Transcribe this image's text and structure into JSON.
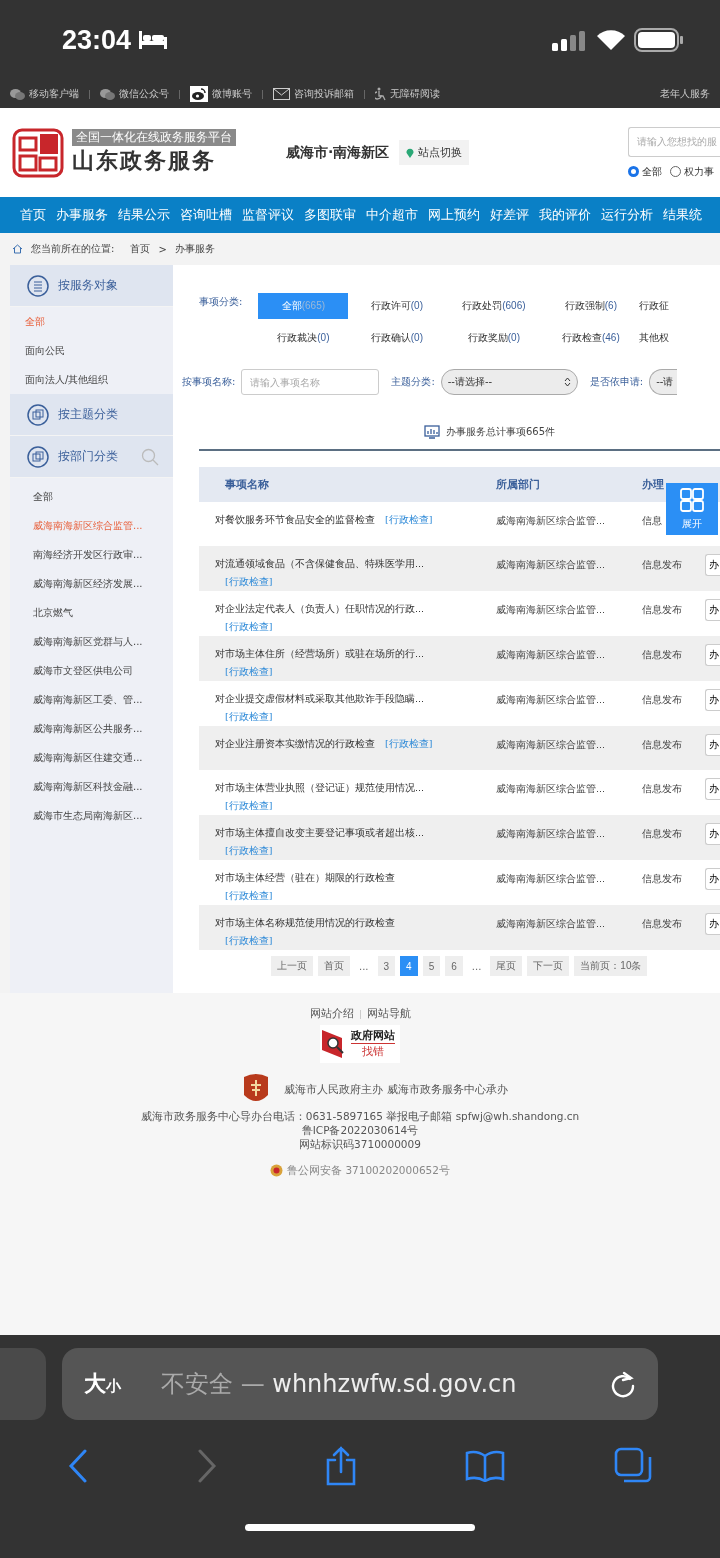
{
  "status_bar": {
    "time": "23:04"
  },
  "top_links": [
    {
      "label": "移动客户端",
      "kind": "phone"
    },
    {
      "label": "微信公众号",
      "kind": "wechat"
    },
    {
      "label": "微博账号",
      "kind": "weibo"
    },
    {
      "label": "咨询投诉邮箱",
      "kind": "mail"
    },
    {
      "label": "无障碍阅读",
      "kind": "access"
    }
  ],
  "top_right_link": "老年人服务",
  "header": {
    "platform_tag": "全国一体化在线政务服务平台",
    "site_name": "山东政务服务",
    "region": "威海市·南海新区",
    "switch_button": "站点切换",
    "search_placeholder": "请输入您想找的服",
    "scopes": [
      {
        "label": "全部",
        "selected": true
      },
      {
        "label": "权力事",
        "selected": false
      }
    ]
  },
  "nav": [
    "首页",
    "办事服务",
    "结果公示",
    "咨询吐槽",
    "监督评议",
    "多图联审",
    "中介超市",
    "网上预约",
    "好差评",
    "我的评价",
    "运行分析",
    "结果统"
  ],
  "breadcrumb": {
    "prefix": "您当前所在的位置:",
    "items": [
      "首页",
      "办事服务"
    ],
    "separator": ">"
  },
  "sidebar": [
    {
      "title": "按服务对象",
      "search": false,
      "items": [
        {
          "label": "全部",
          "selected": true
        },
        {
          "label": "面向公民",
          "selected": false
        },
        {
          "label": "面向法人/其他组织",
          "selected": false
        }
      ]
    },
    {
      "title": "按主题分类",
      "search": false
    },
    {
      "title": "按部门分类",
      "search": true,
      "items": [
        {
          "label": "全部",
          "selected": false
        },
        {
          "label": "威海南海新区综合监管...",
          "selected": true
        },
        {
          "label": "南海经济开发区行政审...",
          "selected": false
        },
        {
          "label": "威海南海新区经济发展...",
          "selected": false
        },
        {
          "label": "北京燃气",
          "selected": false
        },
        {
          "label": "威海南海新区党群与人...",
          "selected": false
        },
        {
          "label": "威海市文登区供电公司",
          "selected": false
        },
        {
          "label": "威海南海新区工委、管...",
          "selected": false
        },
        {
          "label": "威海南海新区公共服务...",
          "selected": false
        },
        {
          "label": "威海南海新区住建交通...",
          "selected": false
        },
        {
          "label": "威海南海新区科技金融...",
          "selected": false
        },
        {
          "label": "威海市生态局南海新区...",
          "selected": false
        }
      ]
    }
  ],
  "filters": {
    "category_label": "事项分类:",
    "categories": [
      {
        "name": "全部",
        "count": "(665)",
        "selected": true
      },
      {
        "name": "行政许可",
        "count": "(0)",
        "selected": false
      },
      {
        "name": "行政处罚",
        "count": "(606)",
        "selected": false
      },
      {
        "name": "行政强制",
        "count": "(6)",
        "selected": false
      },
      {
        "name": "行政征",
        "selected": false
      },
      {
        "name": "行政裁决",
        "count": "(0)",
        "selected": false
      },
      {
        "name": "行政确认",
        "count": "(0)",
        "selected": false
      },
      {
        "name": "行政奖励",
        "count": "(0)",
        "selected": false
      },
      {
        "name": "行政检查",
        "count": "(46)",
        "selected": false
      },
      {
        "name": "其他权",
        "selected": false
      }
    ],
    "name_label": "按事项名称:",
    "name_placeholder": "请输入事项名称",
    "theme_label": "主题分类:",
    "theme_value": "--请选择--",
    "apply_label": "是否依申请:",
    "apply_value": "--请"
  },
  "summary": "办事服务总计事项665件",
  "table": {
    "columns": [
      "事项名称",
      "所属部门",
      "办理"
    ],
    "rows": [
      {
        "name": "对餐饮服务环节食品安全的监督检查",
        "tag": "[行政检查]",
        "department": "威海南海新区综合监管...",
        "status": "信息"
      },
      {
        "name": "对流通领域食品（不含保健食品、特殊医学用...",
        "tag": "[行政检查]",
        "department": "威海南海新区综合监管...",
        "status": "信息发布",
        "action": "办"
      },
      {
        "name": "对企业法定代表人（负责人）任职情况的行政...",
        "tag": "[行政检查]",
        "department": "威海南海新区综合监管...",
        "status": "信息发布",
        "action": "办"
      },
      {
        "name": "对市场主体住所（经营场所）或驻在场所的行...",
        "tag": "[行政检查]",
        "department": "威海南海新区综合监管...",
        "status": "信息发布",
        "action": "办"
      },
      {
        "name": "对企业提交虚假材料或采取其他欺诈手段隐瞒...",
        "tag": "[行政检查]",
        "department": "威海南海新区综合监管...",
        "status": "信息发布",
        "action": "办"
      },
      {
        "name": "对企业注册资本实缴情况的行政检查",
        "tag": "[行政检查]",
        "department": "威海南海新区综合监管...",
        "status": "信息发布",
        "action": "办"
      },
      {
        "name": "对市场主体营业执照（登记证）规范使用情况...",
        "tag": "[行政检查]",
        "department": "威海南海新区综合监管...",
        "status": "信息发布",
        "action": "办"
      },
      {
        "name": "对市场主体擅自改变主要登记事项或者超出核...",
        "tag": "[行政检查]",
        "department": "威海南海新区综合监管...",
        "status": "信息发布",
        "action": "办"
      },
      {
        "name": "对市场主体经营（驻在）期限的行政检查",
        "tag": "[行政检查]",
        "department": "威海南海新区综合监管...",
        "status": "信息发布",
        "action": "办"
      },
      {
        "name": "对市场主体名称规范使用情况的行政检查",
        "tag": "[行政检查]",
        "department": "威海南海新区综合监管...",
        "status": "信息发布",
        "action": "办"
      }
    ]
  },
  "expand_button": "展开",
  "pagination": [
    {
      "label": "上一页",
      "kind": "button",
      "selected": false
    },
    {
      "label": "首页",
      "kind": "button",
      "selected": false
    },
    {
      "label": "...",
      "kind": "gap"
    },
    {
      "label": "3",
      "kind": "button",
      "selected": false
    },
    {
      "label": "4",
      "kind": "button",
      "selected": true
    },
    {
      "label": "5",
      "kind": "button",
      "selected": false
    },
    {
      "label": "6",
      "kind": "button",
      "selected": false
    },
    {
      "label": "...",
      "kind": "gap"
    },
    {
      "label": "尾页",
      "kind": "button",
      "selected": false
    },
    {
      "label": "下一页",
      "kind": "button",
      "selected": false
    },
    {
      "label": "当前页：10条",
      "kind": "button",
      "selected": false
    }
  ],
  "footer": {
    "links": [
      "网站介绍",
      "网站导航"
    ],
    "badge_title": "政府网站",
    "badge_sub": "找错",
    "sponsor": "威海市人民政府主办 威海市政务服务中心承办",
    "contact": "威海市政务服务中心导办台电话：0631-5897165 举报电子邮箱 spfwj@wh.shandong.cn",
    "icp": "鲁ICP备2022030614号",
    "site_code": "网站标识码3710000009",
    "police": "鲁公网安备 37100202000652号"
  },
  "browser": {
    "size_large": "大",
    "size_small": "小",
    "insecure": "不安全 —",
    "domain": "whnhzwfw.sd.gov.cn"
  }
}
